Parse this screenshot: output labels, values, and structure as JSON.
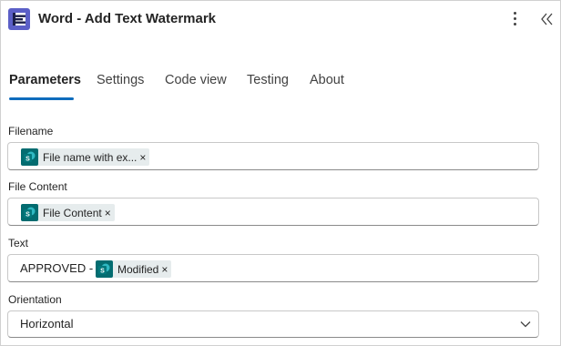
{
  "header": {
    "title": "Word - Add Text Watermark",
    "app_icon": "encodian-logo-icon",
    "more_icon": "more-vertical-icon",
    "collapse_icon": "double-chevron-left-icon"
  },
  "tabs": [
    {
      "label": "Parameters",
      "active": true
    },
    {
      "label": "Settings",
      "active": false
    },
    {
      "label": "Code view",
      "active": false
    },
    {
      "label": "Testing",
      "active": false
    },
    {
      "label": "About",
      "active": false
    }
  ],
  "fields": {
    "filename": {
      "label": "Filename",
      "token": {
        "label": "File name with ex...",
        "remove": "×",
        "icon": "sharepoint-icon"
      }
    },
    "file_content": {
      "label": "File Content",
      "token": {
        "label": "File Content",
        "remove": "×",
        "icon": "sharepoint-icon"
      }
    },
    "text": {
      "label": "Text",
      "prefix": "APPROVED -",
      "token": {
        "label": "Modified",
        "remove": "×",
        "icon": "sharepoint-icon"
      }
    },
    "orientation": {
      "label": "Orientation",
      "value": "Horizontal",
      "icon": "chevron-down-icon"
    }
  },
  "colors": {
    "accent": "#0f6cbd",
    "app_icon_bg": "#5b5fc7",
    "token_bg": "#e6eced",
    "token_icon_bg": "#036c70"
  }
}
